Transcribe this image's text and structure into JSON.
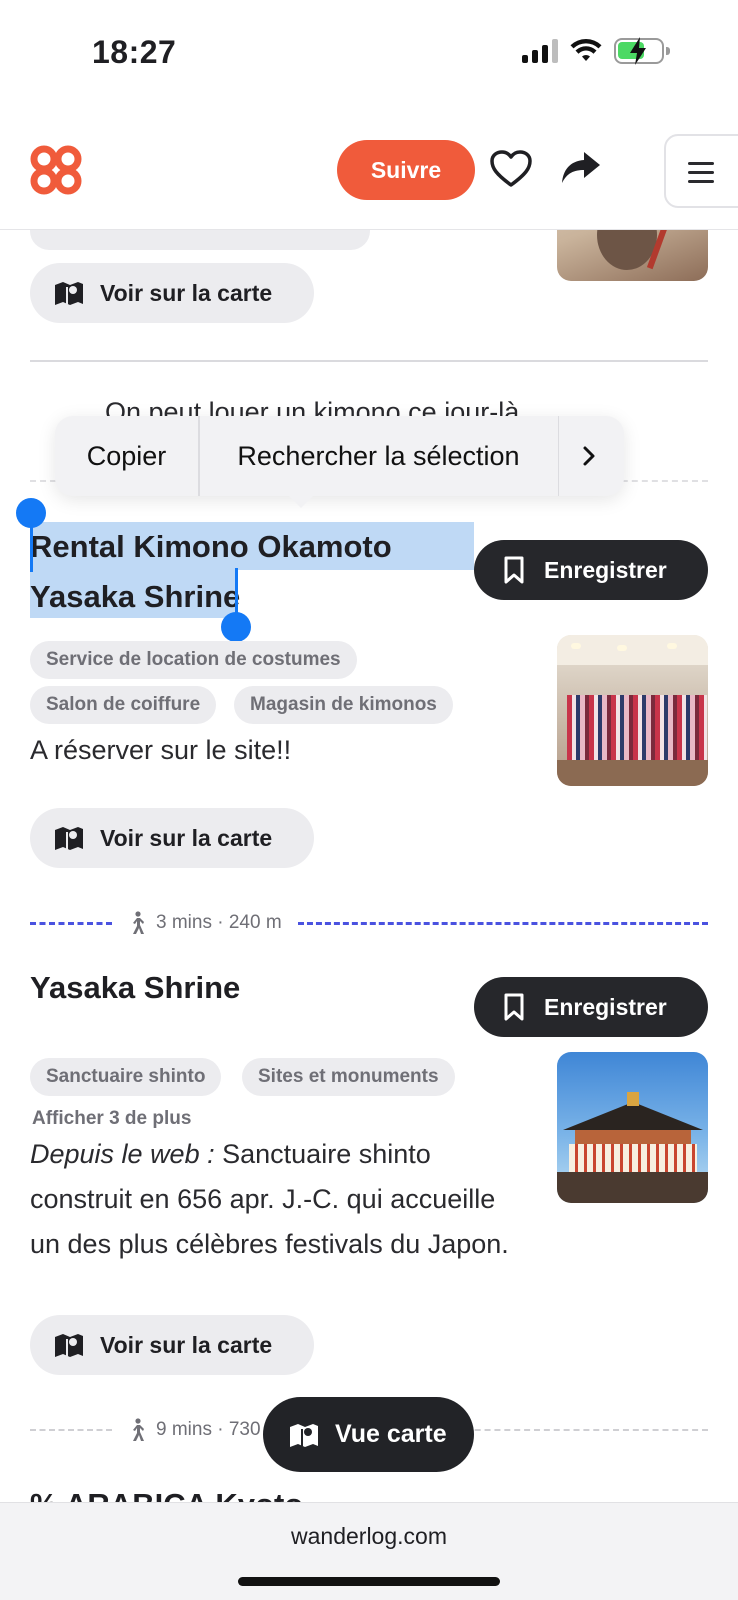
{
  "status_bar": {
    "time": "18:27"
  },
  "header": {
    "follow_label": "Suivre",
    "icons": [
      "wanderlog-logo",
      "heart-icon",
      "share-icon",
      "menu-icon"
    ]
  },
  "context_menu": {
    "copy_label": "Copier",
    "search_label": "Rechercher la sélection"
  },
  "peek_text": "On peut louer un kimono ce jour-là",
  "places": [
    {
      "title_lines": [
        "Rental Kimono Okamoto",
        "Yasaka Shrine"
      ],
      "save_label": "Enregistrer",
      "tags": [
        "Service de location de costumes",
        "Salon de coiffure",
        "Magasin de kimonos"
      ],
      "note": "A réserver sur le site!!",
      "map_label": "Voir sur la carte"
    },
    {
      "title": "Yasaka Shrine",
      "save_label": "Enregistrer",
      "tags": [
        "Sanctuaire shinto",
        "Sites et monuments"
      ],
      "more_label": "Afficher 3 de plus",
      "web_prefix": "Depuis le web :",
      "description_lines": [
        "Sanctuaire shinto",
        "construit en 656 apr. J.-C. qui accueille",
        "un des plus célèbres festivals du Japon."
      ],
      "map_label": "Voir sur la carte"
    }
  ],
  "previous_place": {
    "map_label": "Voir sur la carte"
  },
  "travel": [
    {
      "text": "3 mins · 240 m",
      "color": "#4a52e0"
    },
    {
      "text": "9 mins · 730",
      "color": "#c8c8cc"
    }
  ],
  "next_place_peek": "% ARABICA Kyoto",
  "float_button": {
    "label": "Vue carte"
  },
  "browser": {
    "url": "wanderlog.com"
  },
  "colors": {
    "accent": "#f05b3b",
    "selection": "#bfd9f5",
    "handle": "#1479f5",
    "route": "#4a52e0"
  }
}
